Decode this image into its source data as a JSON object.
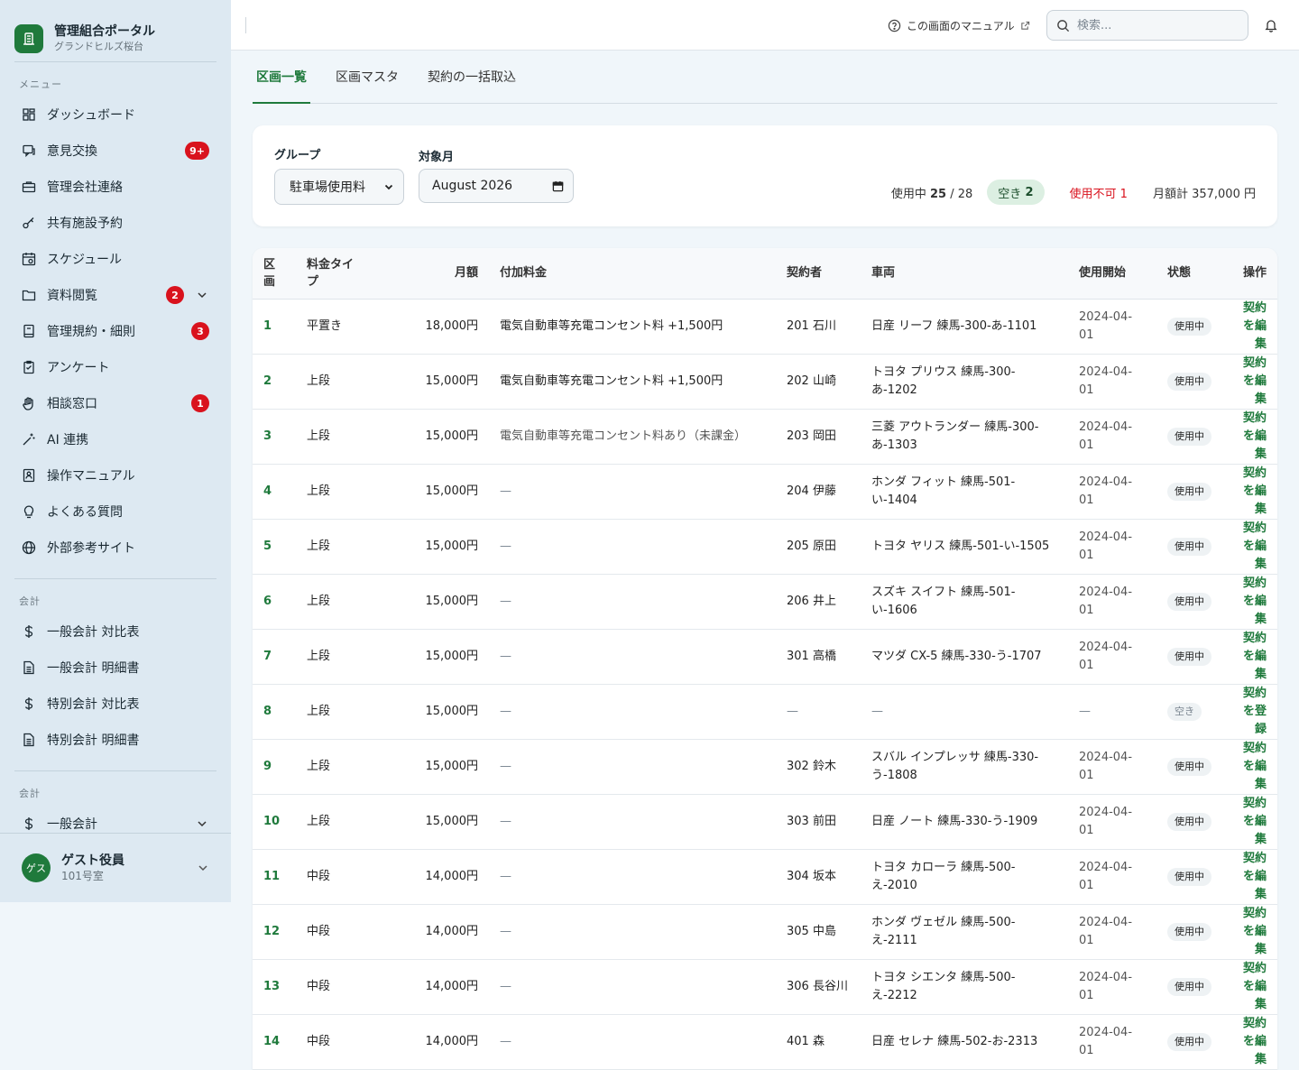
{
  "brand": {
    "title": "管理組合ポータル",
    "subtitle": "グランドヒルズ桜台"
  },
  "sidebar": {
    "menu_label": "メニュー",
    "items": [
      {
        "label": "ダッシュボード",
        "icon": "grid-icon"
      },
      {
        "label": "意見交換",
        "icon": "chat-icon",
        "badge": "9+"
      },
      {
        "label": "管理会社連絡",
        "icon": "briefcase-icon"
      },
      {
        "label": "共有施設予約",
        "icon": "key-icon"
      },
      {
        "label": "スケジュール",
        "icon": "calendar-icon"
      },
      {
        "label": "資料閲覧",
        "icon": "folder-icon",
        "badge": "2"
      },
      {
        "label": "管理規約・細則",
        "icon": "book-icon",
        "badge": "3"
      },
      {
        "label": "アンケート",
        "icon": "clipboard-icon"
      },
      {
        "label": "相談窓口",
        "icon": "hand-icon",
        "badge": "1"
      },
      {
        "label": "AI 連携",
        "icon": "wand-icon"
      },
      {
        "label": "操作マニュアル",
        "icon": "manual-icon"
      },
      {
        "label": "よくある質問",
        "icon": "bulb-icon"
      },
      {
        "label": "外部参考サイト",
        "icon": "globe-icon"
      }
    ],
    "accounting_label": "会計",
    "accounting_items": [
      {
        "label": "一般会計 対比表",
        "icon": "dollar-icon"
      },
      {
        "label": "一般会計 明細書",
        "icon": "document-icon"
      },
      {
        "label": "特別会計 対比表",
        "icon": "dollar-icon"
      },
      {
        "label": "特別会計 明細書",
        "icon": "document-icon"
      }
    ],
    "accounting2_label": "会計",
    "accounting2_items": [
      {
        "label": "一般会計",
        "icon": "dollar-icon"
      }
    ]
  },
  "user": {
    "avatar": "ゲス",
    "name": "ゲスト役員",
    "room": "101号室"
  },
  "topbar": {
    "manual_link": "この画面のマニュアル",
    "search_placeholder": "検索..."
  },
  "tabs": [
    {
      "label": "区画一覧",
      "active": true
    },
    {
      "label": "区画マスタ",
      "active": false
    },
    {
      "label": "契約の一括取込",
      "active": false
    }
  ],
  "filters": {
    "group_label": "グループ",
    "group_value": "駐車場使用料",
    "month_label": "対象月",
    "month_value": "August 2026"
  },
  "summary": {
    "in_use_label": "使用中",
    "in_use": "25",
    "total": "28",
    "vacant_label": "空き",
    "vacant": "2",
    "unavailable_label": "使用不可",
    "unavailable": "1",
    "monthly_label": "月額計",
    "monthly_total": "357,000 円"
  },
  "table": {
    "headers": {
      "lot": "区画",
      "fee_type": "料金タイプ",
      "amount": "月額",
      "extra": "付加料金",
      "contractor": "契約者",
      "vehicle": "車両",
      "start": "使用開始",
      "status": "状態",
      "action": "操作"
    },
    "rows": [
      {
        "lot": "1",
        "fee_type": "平置き",
        "amount": "18,000円",
        "extra": "電気自動車等充電コンセント料 +1,500円",
        "contractor": "201 石川",
        "vehicle": "日産 リーフ 練馬-300-あ-1101",
        "start": "2024-04-01",
        "status": "使用中",
        "action": "契約を編集",
        "tall": false
      },
      {
        "lot": "2",
        "fee_type": "上段",
        "amount": "15,000円",
        "extra": "電気自動車等充電コンセント料 +1,500円",
        "contractor": "202 山崎",
        "vehicle": "トヨタ プリウス 練馬-300-あ-1202",
        "start": "2024-04-01",
        "status": "使用中",
        "action": "契約を編集",
        "tall": true
      },
      {
        "lot": "3",
        "fee_type": "上段",
        "amount": "15,000円",
        "extra": "電気自動車等充電コンセント料あり（未課金）",
        "contractor": "203 岡田",
        "vehicle": "三菱 アウトランダー 練馬-300-あ-1303",
        "start": "2024-04-01",
        "status": "使用中",
        "action": "契約を編集",
        "tall": true,
        "muted": true
      },
      {
        "lot": "4",
        "fee_type": "上段",
        "amount": "15,000円",
        "extra": "—",
        "contractor": "204 伊藤",
        "vehicle": "ホンダ フィット 練馬-501-い-1404",
        "start": "2024-04-01",
        "status": "使用中",
        "action": "契約を編集",
        "tall": true
      },
      {
        "lot": "5",
        "fee_type": "上段",
        "amount": "15,000円",
        "extra": "—",
        "contractor": "205 原田",
        "vehicle": "トヨタ ヤリス 練馬-501-い-1505",
        "start": "2024-04-01",
        "status": "使用中",
        "action": "契約を編集",
        "tall": false
      },
      {
        "lot": "6",
        "fee_type": "上段",
        "amount": "15,000円",
        "extra": "—",
        "contractor": "206 井上",
        "vehicle": "スズキ スイフト 練馬-501-い-1606",
        "start": "2024-04-01",
        "status": "使用中",
        "action": "契約を編集",
        "tall": true
      },
      {
        "lot": "7",
        "fee_type": "上段",
        "amount": "15,000円",
        "extra": "—",
        "contractor": "301 高橋",
        "vehicle": "マツダ CX-5 練馬-330-う-1707",
        "start": "2024-04-01",
        "status": "使用中",
        "action": "契約を編集",
        "tall": false
      },
      {
        "lot": "8",
        "fee_type": "上段",
        "amount": "15,000円",
        "extra": "—",
        "contractor": "—",
        "vehicle": "—",
        "start": "—",
        "status": "空き",
        "action": "契約を登録",
        "tall": false,
        "vacant": true
      },
      {
        "lot": "9",
        "fee_type": "上段",
        "amount": "15,000円",
        "extra": "—",
        "contractor": "302 鈴木",
        "vehicle": "スバル インプレッサ 練馬-330-う-1808",
        "start": "2024-04-01",
        "status": "使用中",
        "action": "契約を編集",
        "tall": true
      },
      {
        "lot": "10",
        "fee_type": "上段",
        "amount": "15,000円",
        "extra": "—",
        "contractor": "303 前田",
        "vehicle": "日産 ノート 練馬-330-う-1909",
        "start": "2024-04-01",
        "status": "使用中",
        "action": "契約を編集",
        "tall": false
      },
      {
        "lot": "11",
        "fee_type": "中段",
        "amount": "14,000円",
        "extra": "—",
        "contractor": "304 坂本",
        "vehicle": "トヨタ カローラ 練馬-500-え-2010",
        "start": "2024-04-01",
        "status": "使用中",
        "action": "契約を編集",
        "tall": true
      },
      {
        "lot": "12",
        "fee_type": "中段",
        "amount": "14,000円",
        "extra": "—",
        "contractor": "305 中島",
        "vehicle": "ホンダ ヴェゼル 練馬-500-え-2111",
        "start": "2024-04-01",
        "status": "使用中",
        "action": "契約を編集",
        "tall": true
      },
      {
        "lot": "13",
        "fee_type": "中段",
        "amount": "14,000円",
        "extra": "—",
        "contractor": "306 長谷川",
        "vehicle": "トヨタ シエンタ 練馬-500-え-2212",
        "start": "2024-04-01",
        "status": "使用中",
        "action": "契約を編集",
        "tall": true
      },
      {
        "lot": "14",
        "fee_type": "中段",
        "amount": "14,000円",
        "extra": "—",
        "contractor": "401 森",
        "vehicle": "日産 セレナ 練馬-502-お-2313",
        "start": "2024-04-01",
        "status": "使用中",
        "action": "契約を編集",
        "tall": false
      }
    ]
  }
}
